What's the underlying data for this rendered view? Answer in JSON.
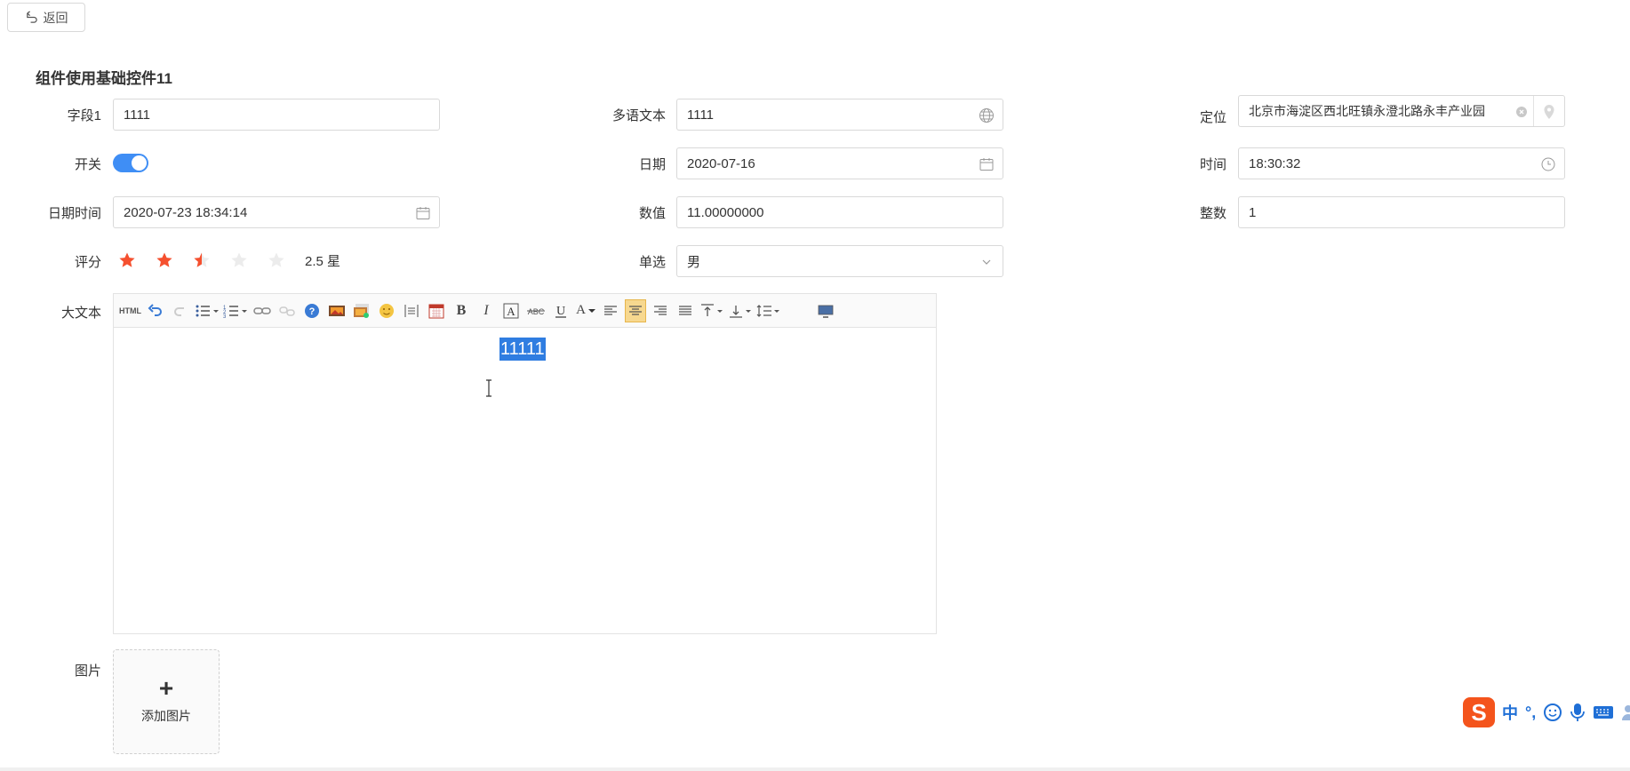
{
  "back": {
    "label": "返回"
  },
  "title": "组件使用基础控件11",
  "fields": {
    "field1": {
      "label": "字段1",
      "value": "1111"
    },
    "multilang": {
      "label": "多语文本",
      "value": "1111"
    },
    "location": {
      "label": "定位",
      "value": "北京市海淀区西北旺镇永澄北路永丰产业园"
    },
    "switch": {
      "label": "开关",
      "on": true
    },
    "date": {
      "label": "日期",
      "value": "2020-07-16"
    },
    "time": {
      "label": "时间",
      "value": "18:30:32"
    },
    "datetime": {
      "label": "日期时间",
      "value": "2020-07-23 18:34:14"
    },
    "number": {
      "label": "数值",
      "value": "11.00000000"
    },
    "integer": {
      "label": "整数",
      "value": "1"
    },
    "rating": {
      "label": "评分",
      "value": 2.5,
      "max": 5,
      "text": "2.5 星"
    },
    "single": {
      "label": "单选",
      "value": "男"
    },
    "bigtext": {
      "label": "大文本",
      "content": "11111"
    },
    "image": {
      "label": "图片",
      "add_label": "添加图片",
      "add_icon": "+"
    }
  },
  "toolbar": {
    "html_label": "HTML",
    "bold": "B",
    "italic": "I",
    "font_color": "A"
  },
  "ime": {
    "logo": "S",
    "mode": "中",
    "punct": "°,"
  },
  "colors": {
    "accent": "#3f8ef5",
    "star": "#f5502f",
    "selection": "#2f7de1"
  }
}
